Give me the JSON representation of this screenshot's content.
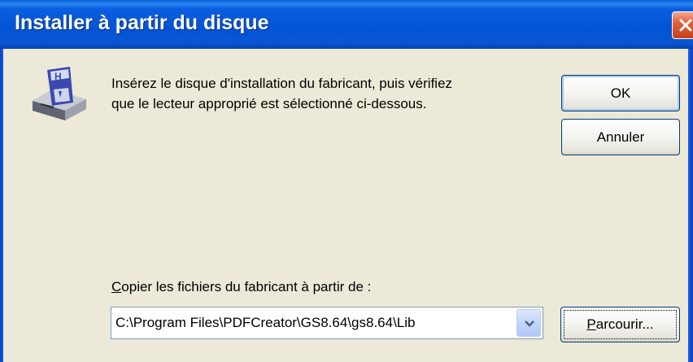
{
  "window": {
    "title": "Installer à partir du disque",
    "close_icon": "close-icon"
  },
  "dialog": {
    "icon": "floppy-disk-drive-icon",
    "message_line1": "Insérez le disque d'installation du fabricant, puis vérifiez",
    "message_line2": "que le lecteur approprié est sélectionné ci-dessous."
  },
  "buttons": {
    "ok_label": "OK",
    "cancel_label": "Annuler",
    "browse_label_accel": "P",
    "browse_label_rest": "arcourir..."
  },
  "copy_from": {
    "label_accel": "C",
    "label_rest": "opier les fichiers du fabricant à partir de :",
    "path_value": "C:\\Program Files\\PDFCreator\\GS8.64\\gs8.64\\Lib",
    "dropdown_icon": "chevron-down-icon"
  },
  "colors": {
    "titlebar": "#0254d4",
    "dialog_background": "#ece9d8",
    "close_button": "#e0603c"
  }
}
